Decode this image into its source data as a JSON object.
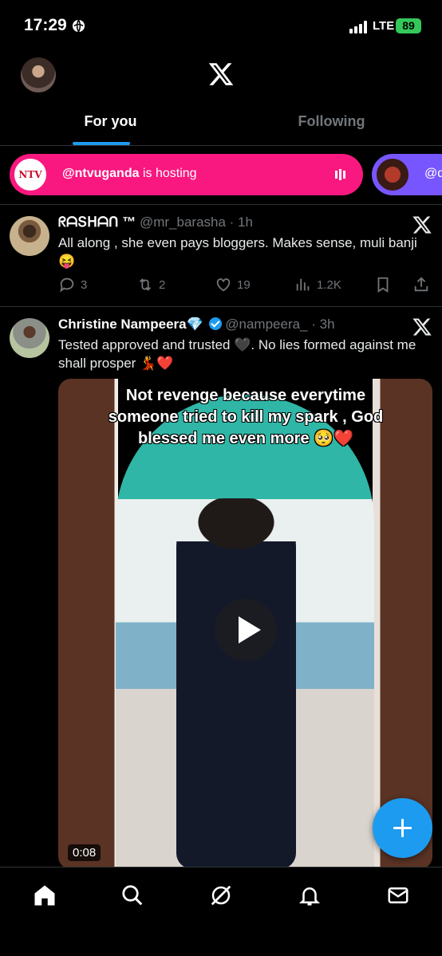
{
  "status_bar": {
    "time": "17:29",
    "network": "LTE",
    "battery": "89"
  },
  "header": {
    "logo": "x-logo-icon",
    "tabs": [
      {
        "label": "For you",
        "active": true
      },
      {
        "label": "Following",
        "active": false
      }
    ]
  },
  "spaces": [
    {
      "logo_text": "NTV",
      "host": "@ntvuganda",
      "suffix": " is hosting",
      "color": "#f91880"
    },
    {
      "host": "@d",
      "color": "#7856ff"
    }
  ],
  "tweets": [
    {
      "name": "ᖇᗩՏᕼᗩᑎ ™",
      "handle": "@mr_barasha",
      "time": "· 1h",
      "text": "All along , she even pays bloggers. Makes sense, muli banji 😝",
      "replies": "3",
      "retweets": "2",
      "likes": "19",
      "views": "1.2K"
    },
    {
      "name": "Christine Nampeera💎",
      "handle": "@nampeera_",
      "time": "· 3h",
      "verified": true,
      "text": "Tested approved and trusted 🖤. No lies formed against me shall prosper 💃❤️",
      "media": {
        "caption": "Not revenge because everytime someone tried to kill my spark , God blessed me even more 🥺❤️",
        "duration": "0:08"
      }
    }
  ],
  "bottom_nav": [
    "home-icon",
    "search-icon",
    "grok-icon",
    "notifications-icon",
    "messages-icon"
  ],
  "colors": {
    "accent": "#1d9bf0",
    "background": "#000000",
    "secondary_text": "#71767b"
  }
}
